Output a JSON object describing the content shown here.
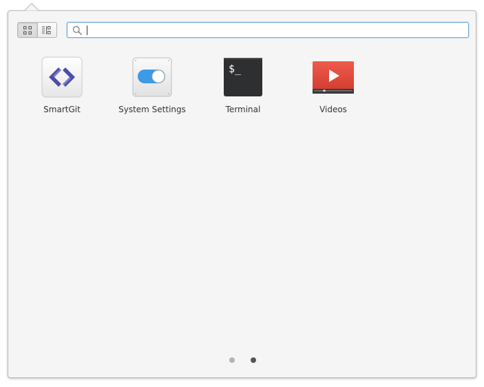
{
  "search": {
    "value": "",
    "placeholder": ""
  },
  "view_switcher": {
    "grid_view_icon": "grid-view-icon",
    "category_view_icon": "category-view-icon",
    "active": "grid"
  },
  "apps": [
    {
      "label": "SmartGit",
      "icon": "smartgit-icon"
    },
    {
      "label": "System Settings",
      "icon": "system-settings-icon"
    },
    {
      "label": "Terminal",
      "icon": "terminal-icon"
    },
    {
      "label": "Videos",
      "icon": "videos-icon"
    }
  ],
  "terminal_icon_text": "$_",
  "pager": {
    "pages": 2,
    "current_page": 2
  },
  "colors": {
    "accent": "#3d9ae6",
    "videos_red": "#df4135",
    "terminal_bg": "#2e2f30",
    "smartgit_purple": "#4b4fa8"
  }
}
